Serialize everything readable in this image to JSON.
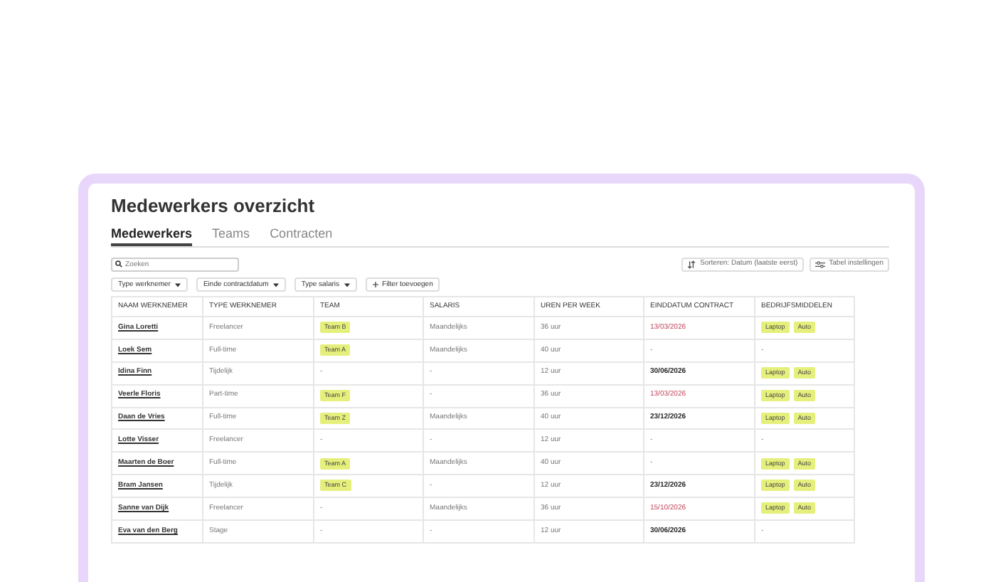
{
  "title": "Medewerkers overzicht",
  "tabs": [
    {
      "label": "Medewerkers",
      "selected": true
    },
    {
      "label": "Teams",
      "selected": false
    },
    {
      "label": "Contracten",
      "selected": false
    }
  ],
  "search": {
    "placeholder": "Zoeken"
  },
  "sort_button": "Sorteren: Datum (laatste eerst)",
  "settings_button": "Tabel instellingen",
  "filters": [
    {
      "label": "Type werknemer",
      "kind": "dropdown"
    },
    {
      "label": "Einde contractdatum",
      "kind": "dropdown"
    },
    {
      "label": "Type salaris",
      "kind": "dropdown"
    },
    {
      "label": "Filter toevoegen",
      "kind": "add"
    }
  ],
  "table": {
    "columns": [
      "NAAM WERKNEMER",
      "TYPE WERKNEMER",
      "TEAM",
      "SALARIS",
      "UREN PER WEEK",
      "EINDDATUM CONTRACT",
      "BEDRIJFSMIDDELEN"
    ],
    "rows": [
      {
        "name": "Gina Loretti",
        "type": "Freelancer",
        "team": {
          "kind": "badge",
          "text": "Team B"
        },
        "salary": "Maandelijks",
        "hours": "36 uur",
        "end_date": {
          "kind": "expiring",
          "text": "13/03/2026"
        },
        "assets": [
          {
            "kind": "badge",
            "text": "Laptop"
          },
          {
            "kind": "badge",
            "text": "Auto"
          }
        ]
      },
      {
        "name": "Loek Sem",
        "type": "Full-time",
        "team": {
          "kind": "badge",
          "text": "Team A"
        },
        "salary": "Maandelijks",
        "hours": "40 uur",
        "end_date": {
          "kind": "empty",
          "text": "-"
        },
        "assets": [
          {
            "kind": "text",
            "text": "-"
          }
        ]
      },
      {
        "name": "Idina Finn",
        "type": "Tijdelijk",
        "team": {
          "kind": "text",
          "text": "-"
        },
        "salary": "-",
        "hours": "12 uur",
        "end_date": {
          "kind": "date",
          "text": "30/06/2026"
        },
        "assets": [
          {
            "kind": "badge",
            "text": "Laptop"
          },
          {
            "kind": "badge",
            "text": "Auto"
          }
        ]
      },
      {
        "name": "Veerle Floris",
        "type": "Part-time",
        "team": {
          "kind": "badge",
          "text": "Team F"
        },
        "salary": "-",
        "hours": "36 uur",
        "end_date": {
          "kind": "expiring",
          "text": "13/03/2026"
        },
        "assets": [
          {
            "kind": "badge",
            "text": "Laptop"
          },
          {
            "kind": "badge",
            "text": "Auto"
          }
        ]
      },
      {
        "name": "Daan de Vries",
        "type": "Full-time",
        "team": {
          "kind": "badge",
          "text": "Team Z"
        },
        "salary": "Maandelijks",
        "hours": "40 uur",
        "end_date": {
          "kind": "date",
          "text": "23/12/2026"
        },
        "assets": [
          {
            "kind": "badge",
            "text": "Laptop"
          },
          {
            "kind": "badge",
            "text": "Auto"
          }
        ]
      },
      {
        "name": "Lotte Visser",
        "type": "Freelancer",
        "team": {
          "kind": "text",
          "text": "-"
        },
        "salary": "-",
        "hours": "12 uur",
        "end_date": {
          "kind": "empty",
          "text": "-"
        },
        "assets": [
          {
            "kind": "text",
            "text": "-"
          }
        ]
      },
      {
        "name": "Maarten de Boer",
        "type": "Full-time",
        "team": {
          "kind": "badge",
          "text": "Team A"
        },
        "salary": "Maandelijks",
        "hours": "40 uur",
        "end_date": {
          "kind": "empty",
          "text": "-"
        },
        "assets": [
          {
            "kind": "badge",
            "text": "Laptop"
          },
          {
            "kind": "badge",
            "text": "Auto"
          }
        ]
      },
      {
        "name": "Bram Jansen",
        "type": "Tijdelijk",
        "team": {
          "kind": "badge",
          "text": "Team C"
        },
        "salary": "-",
        "hours": "12 uur",
        "end_date": {
          "kind": "date",
          "text": "23/12/2026"
        },
        "assets": [
          {
            "kind": "badge",
            "text": "Laptop"
          },
          {
            "kind": "badge",
            "text": "Auto"
          }
        ]
      },
      {
        "name": "Sanne van Dijk",
        "type": "Freelancer",
        "team": {
          "kind": "text",
          "text": "-"
        },
        "salary": "Maandelijks",
        "hours": "36 uur",
        "end_date": {
          "kind": "expiring",
          "text": "15/10/2026"
        },
        "assets": [
          {
            "kind": "badge",
            "text": "Laptop"
          },
          {
            "kind": "badge",
            "text": "Auto"
          }
        ]
      },
      {
        "name": "Eva van den Berg",
        "type": "Stage",
        "team": {
          "kind": "text",
          "text": "-"
        },
        "salary": "-",
        "hours": "12 uur",
        "end_date": {
          "kind": "date",
          "text": "30/06/2026"
        },
        "assets": [
          {
            "kind": "text",
            "text": "-"
          }
        ]
      }
    ]
  }
}
